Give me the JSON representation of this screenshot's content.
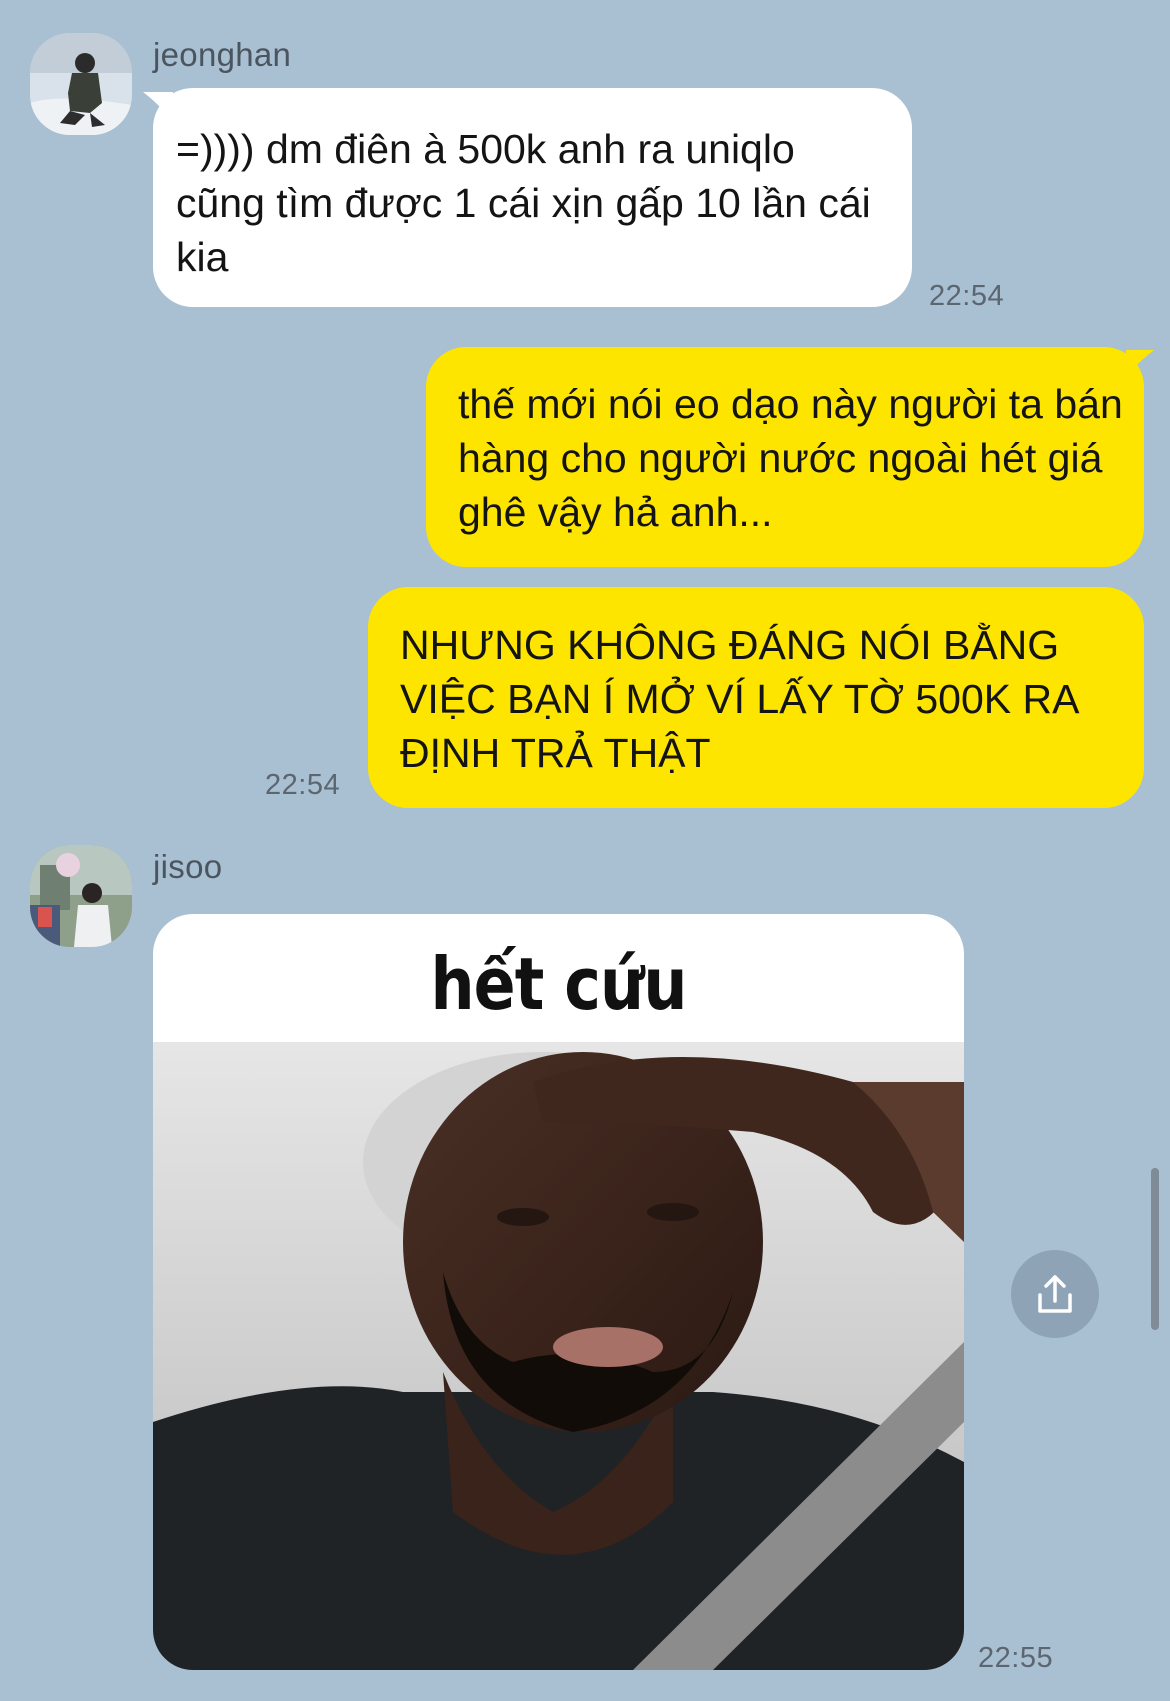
{
  "colors": {
    "background": "#a9bfd2",
    "incoming_bubble": "#ffffff",
    "outgoing_bubble": "#fee500"
  },
  "messages": [
    {
      "sender": "jeonghan",
      "avatar": "jeonghan-avatar",
      "direction": "incoming",
      "text": "=)))) dm điên à 500k anh ra uniqlo cũng tìm được 1 cái xịn gấp 10 lần cái kia",
      "time": "22:54"
    },
    {
      "direction": "outgoing",
      "text": "thế mới nói eo dạo này người ta bán hàng cho người nước ngoài hét giá ghê vậy hả anh..."
    },
    {
      "direction": "outgoing",
      "text": "NHƯNG KHÔNG ĐÁNG NÓI BẰNG VIỆC BẠN Í MỞ VÍ LẤY TỜ 500K RA ĐỊNH TRẢ THẬT",
      "time": "22:54"
    },
    {
      "sender": "jisoo",
      "avatar": "jisoo-avatar",
      "direction": "incoming",
      "image_caption": "hết cứu",
      "time": "22:55"
    }
  ],
  "controls": {
    "share_icon": "share-icon"
  }
}
